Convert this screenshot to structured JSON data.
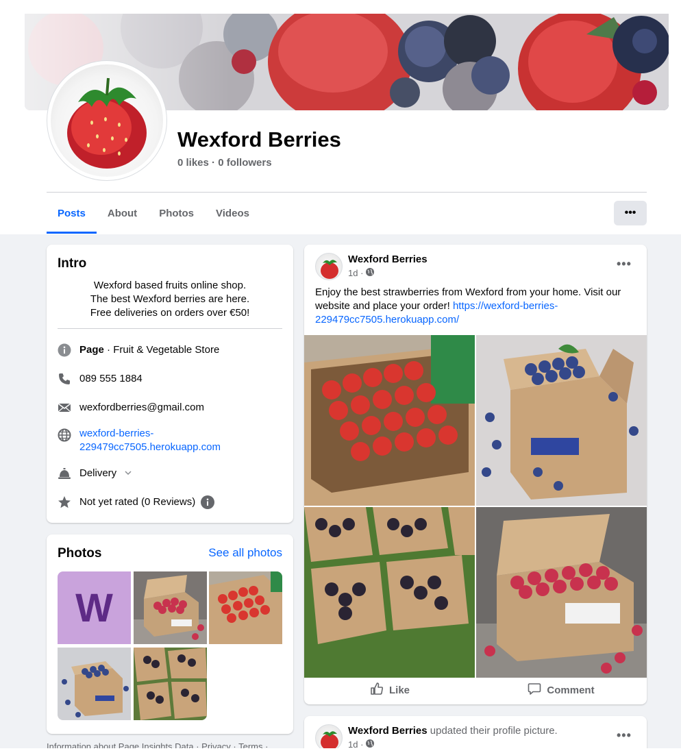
{
  "page": {
    "name": "Wexford Berries",
    "stats": "0 likes · 0 followers"
  },
  "tabs": [
    {
      "label": "Posts"
    },
    {
      "label": "About"
    },
    {
      "label": "Photos"
    },
    {
      "label": "Videos"
    }
  ],
  "more_label": "•••",
  "intro": {
    "title": "Intro",
    "bio": [
      "Wexford based fruits online shop.",
      "The best Wexford berries are here.",
      "Free deliveries on orders over €50!"
    ],
    "page_label": "Page",
    "category": " · Fruit & Vegetable Store",
    "phone": "089 555 1884",
    "email": "wexfordberries@gmail.com",
    "website_line1": "wexford-berries-",
    "website_line2": "229479cc7505.herokuapp.com",
    "delivery": "Delivery",
    "rating": "Not yet rated (0 Reviews)"
  },
  "photos": {
    "title": "Photos",
    "see_all": "See all photos",
    "logo_letter": "W"
  },
  "footer": "Information about Page Insights Data · Privacy · Terms ·",
  "post1": {
    "author": "Wexford Berries",
    "time": "1d ·",
    "text": "Enjoy the best strawberries from Wexford from your home. Visit our website and place your order! ",
    "link": "https://wexford-berries-229479cc7505.herokuapp.com/",
    "like": "Like",
    "comment": "Comment"
  },
  "post2": {
    "author": "Wexford Berries",
    "action": " updated their profile picture.",
    "time": "1d ·"
  },
  "colors": {
    "accent": "#0866ff",
    "background": "#f0f2f5",
    "muted": "#65676b"
  }
}
